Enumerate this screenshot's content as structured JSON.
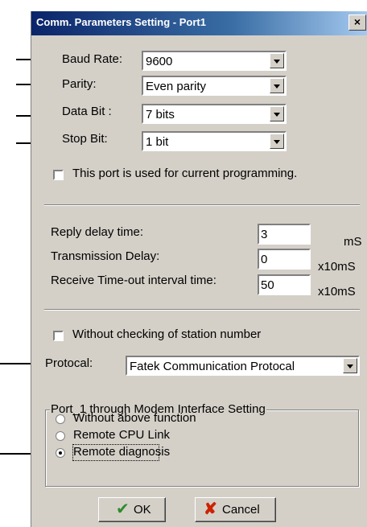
{
  "window": {
    "title": "Comm. Parameters Setting - Port1",
    "close_label": "×"
  },
  "comm": {
    "baud_label": "Baud Rate:",
    "baud_value": "9600",
    "parity_label": "Parity:",
    "parity_value": "Even parity",
    "databit_label": "Data Bit :",
    "databit_value": "7 bits",
    "stopbit_label": "Stop Bit:",
    "stopbit_value": "1 bit"
  },
  "current_programming": {
    "label": "This port is used for current programming.",
    "checked": false
  },
  "timing": {
    "reply_label": "Reply delay time:",
    "reply_value": "3",
    "reply_unit": "mS",
    "trans_label": "Transmission Delay:",
    "trans_value": "0",
    "trans_unit": "x10mS",
    "timeout_label": "Receive Time-out interval time:",
    "timeout_value": "50",
    "timeout_unit": "x10mS"
  },
  "station_check": {
    "label": "Without checking of station number",
    "checked": false
  },
  "protocol": {
    "label": "Protocal:",
    "value": "Fatek Communication Protocal"
  },
  "modem": {
    "group_label": "Port_1 through Modem Interface Setting",
    "options": [
      {
        "label": "Without above function",
        "selected": false
      },
      {
        "label": "Remote CPU Link",
        "selected": false
      },
      {
        "label": "Remote diagnosis",
        "selected": true
      }
    ]
  },
  "buttons": {
    "ok_label": "OK",
    "cancel_label": "Cancel"
  },
  "colors": {
    "dialog_bg": "#d4d0c8",
    "title_start": "#0a246a",
    "title_end": "#a6caf0",
    "ok_icon": "#2e8b2e",
    "cancel_icon": "#cc2200"
  }
}
